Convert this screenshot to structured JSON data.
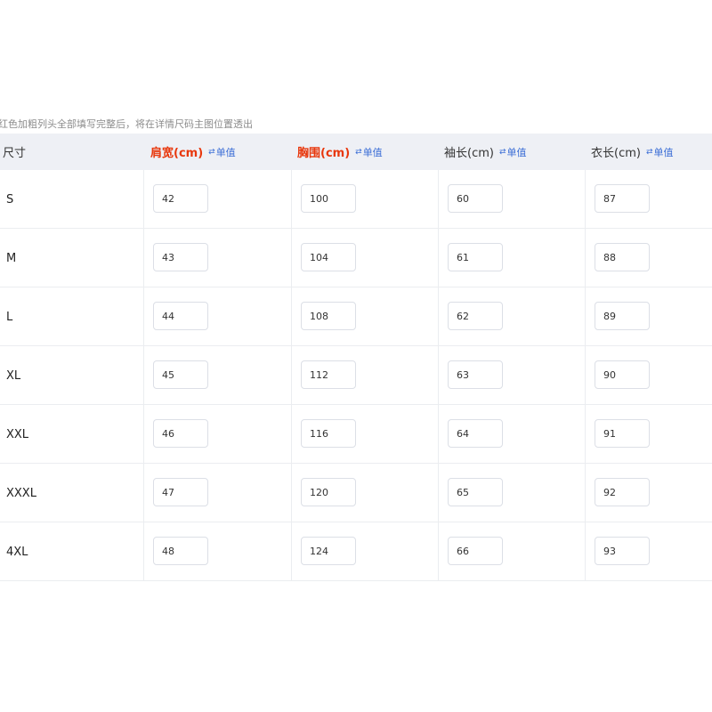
{
  "hint": "红色加粗列头全部填写完整后，将在详情尺码主图位置透出",
  "columns": [
    {
      "label": "尺寸",
      "required": false,
      "toggle": ""
    },
    {
      "label": "肩宽(cm)",
      "required": true,
      "toggle": "单值"
    },
    {
      "label": "胸围(cm)",
      "required": true,
      "toggle": "单值"
    },
    {
      "label": "袖长(cm)",
      "required": false,
      "toggle": "单值"
    },
    {
      "label": "衣长(cm)",
      "required": false,
      "toggle": "单值"
    }
  ],
  "toggle_icon": "swap-icon",
  "colors": {
    "required": "#e8380d",
    "toggle": "#3d6fd6",
    "header_bg": "#eef0f5"
  },
  "rows": [
    {
      "size": "S",
      "shoulder": "42",
      "chest": "100",
      "sleeve": "60",
      "length": "87"
    },
    {
      "size": "M",
      "shoulder": "43",
      "chest": "104",
      "sleeve": "61",
      "length": "88"
    },
    {
      "size": "L",
      "shoulder": "44",
      "chest": "108",
      "sleeve": "62",
      "length": "89"
    },
    {
      "size": "XL",
      "shoulder": "45",
      "chest": "112",
      "sleeve": "63",
      "length": "90"
    },
    {
      "size": "XXL",
      "shoulder": "46",
      "chest": "116",
      "sleeve": "64",
      "length": "91"
    },
    {
      "size": "XXXL",
      "shoulder": "47",
      "chest": "120",
      "sleeve": "65",
      "length": "92"
    },
    {
      "size": "4XL",
      "shoulder": "48",
      "chest": "124",
      "sleeve": "66",
      "length": "93"
    }
  ]
}
